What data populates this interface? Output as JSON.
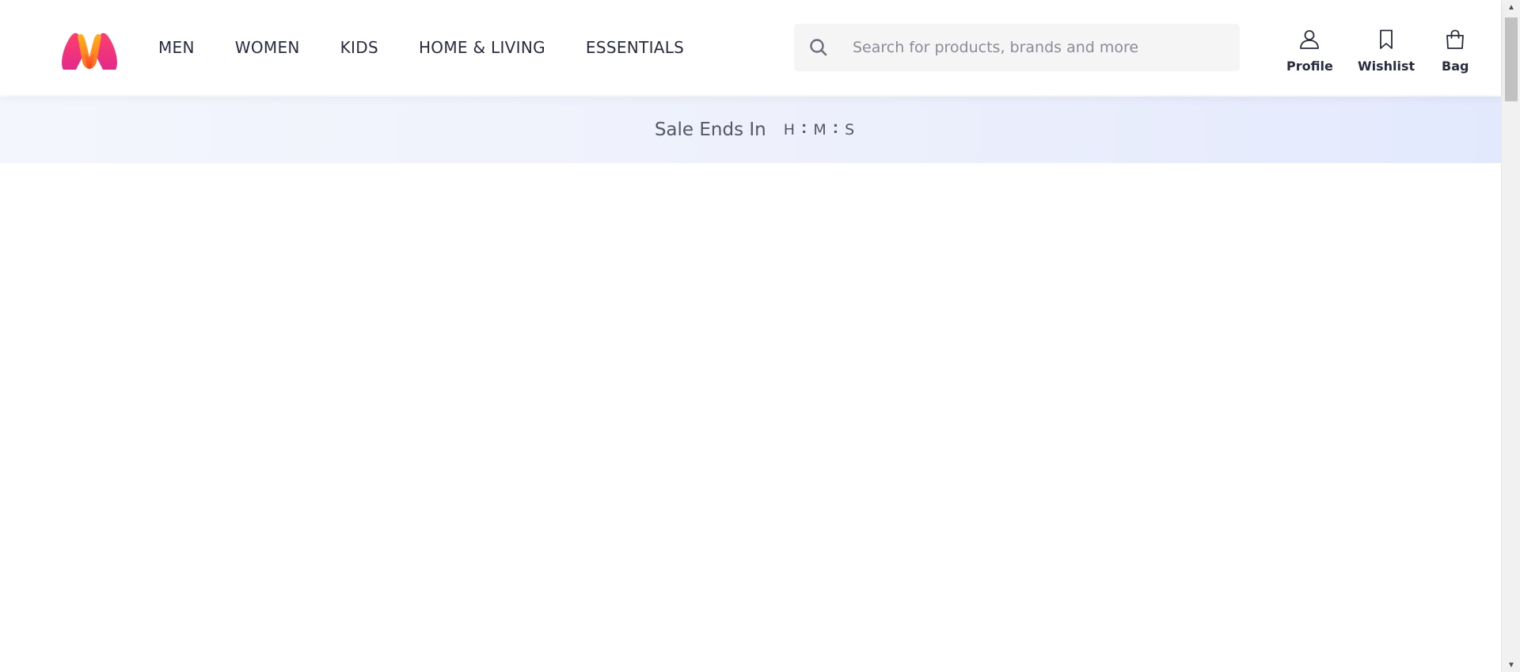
{
  "brand": {
    "accent": "#ff3f6c"
  },
  "nav": {
    "items": [
      {
        "label": "MEN"
      },
      {
        "label": "WOMEN"
      },
      {
        "label": "KIDS"
      },
      {
        "label": "HOME & LIVING"
      },
      {
        "label": "ESSENTIALS"
      }
    ]
  },
  "search": {
    "placeholder": "Search for products, brands and more",
    "value": "",
    "icon": "search-icon"
  },
  "actions": {
    "profile": {
      "label": "Profile",
      "icon": "user-icon"
    },
    "wishlist": {
      "label": "Wishlist",
      "icon": "bookmark-icon"
    },
    "bag": {
      "label": "Bag",
      "icon": "shopping-bag-icon"
    }
  },
  "sale": {
    "label": "Sale Ends In",
    "timer": {
      "hours": "H",
      "minutes": "M",
      "seconds": "S",
      "separator": ":"
    }
  }
}
